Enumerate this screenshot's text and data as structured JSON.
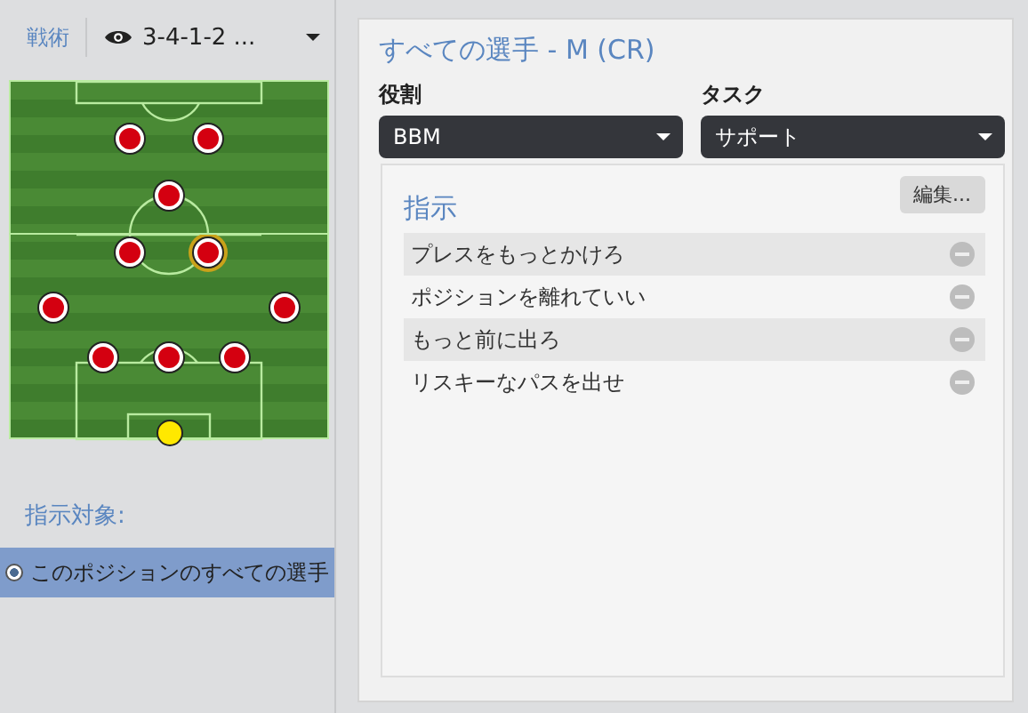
{
  "tactics_tab": {
    "label": "戦術"
  },
  "formation_selector": {
    "value": "3-4-1-2 ..."
  },
  "pitch": {
    "rows": [
      {
        "kind": "forwards",
        "players": [
          {
            "selected": false
          },
          {
            "selected": false
          }
        ]
      },
      {
        "kind": "attacking-mid",
        "players": [
          {
            "selected": false
          }
        ]
      },
      {
        "kind": "midfield",
        "players": [
          {
            "selected": false
          },
          {
            "selected": true
          }
        ]
      },
      {
        "kind": "wide",
        "players": [
          {
            "selected": false
          },
          {
            "selected": false
          }
        ]
      },
      {
        "kind": "defence",
        "players": [
          {
            "selected": false
          },
          {
            "selected": false
          },
          {
            "selected": false
          }
        ]
      },
      {
        "kind": "goalkeeper",
        "players": [
          {
            "selected": false
          }
        ]
      }
    ]
  },
  "target": {
    "heading": "指示対象:",
    "options": [
      {
        "label": "このポジションのすべての選手",
        "selected": true
      }
    ]
  },
  "panel": {
    "title": "すべての選手 - M (CR)",
    "role": {
      "label": "役割",
      "value": "BBM"
    },
    "duty": {
      "label": "タスク",
      "value": "サポート"
    },
    "instructions": {
      "heading": "指示",
      "edit_button": "編集...",
      "items": [
        "プレスをもっとかけろ",
        "ポジションを離れていい",
        "もっと前に出ろ",
        "リスキーなパスを出せ"
      ]
    }
  }
}
